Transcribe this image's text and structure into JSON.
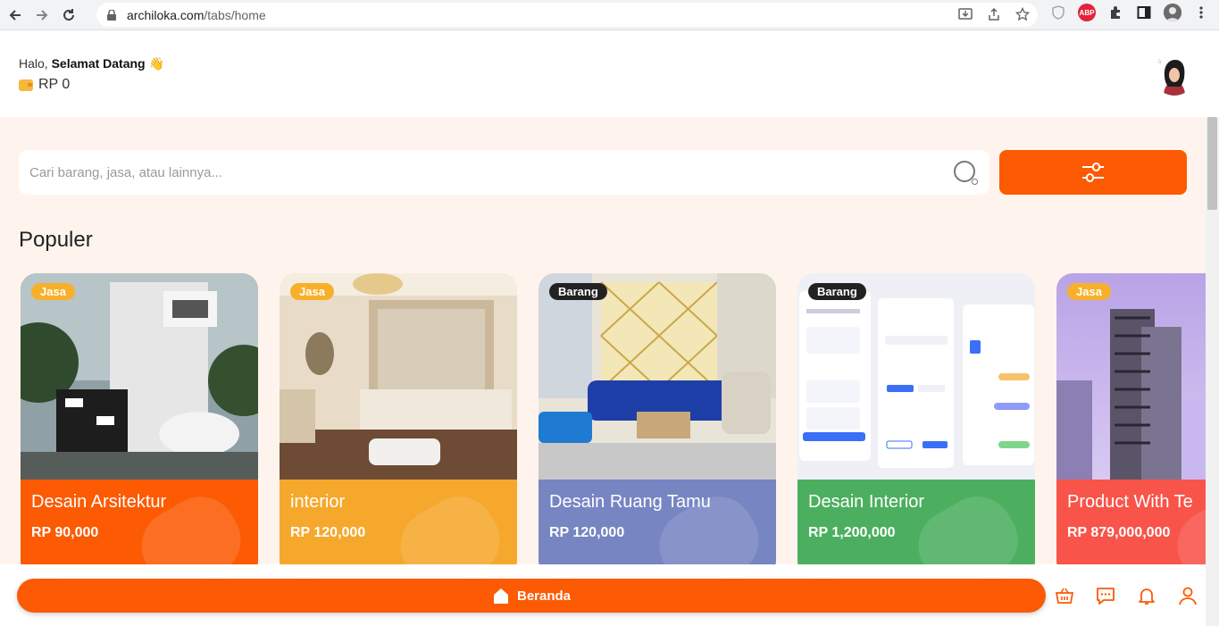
{
  "browser": {
    "url_host": "archiloka.com",
    "url_path": "/tabs/home"
  },
  "header": {
    "greeting_prefix": "Halo,",
    "greeting_name": "Selamat Datang",
    "greeting_emoji": "👋",
    "balance": "RP 0"
  },
  "search": {
    "placeholder": "Cari barang, jasa, atau lainnya..."
  },
  "section": {
    "title": "Populer"
  },
  "cards": [
    {
      "tag": "Jasa",
      "tag_type": "jasa",
      "title": "Desain Arsitektur",
      "price": "RP 90,000",
      "color": "#fc5a03"
    },
    {
      "tag": "Jasa",
      "tag_type": "jasa",
      "title": "interior",
      "price": "RP 120,000",
      "color": "#f6a82c"
    },
    {
      "tag": "Barang",
      "tag_type": "barang",
      "title": "Desain Ruang Tamu",
      "price": "RP 120,000",
      "color": "#7785c2"
    },
    {
      "tag": "Barang",
      "tag_type": "barang",
      "title": "Desain Interior",
      "price": "RP 1,200,000",
      "color": "#4caf5f"
    },
    {
      "tag": "Jasa",
      "tag_type": "jasa",
      "title": "Product With Te",
      "price": "RP 879,000,000",
      "color": "#f8544a"
    }
  ],
  "bottom_nav": {
    "home_label": "Beranda",
    "icons": [
      "basket-icon",
      "chat-icon",
      "bell-icon",
      "user-icon"
    ]
  },
  "colors": {
    "accent": "#fc5a03",
    "background": "#fff4ed"
  }
}
